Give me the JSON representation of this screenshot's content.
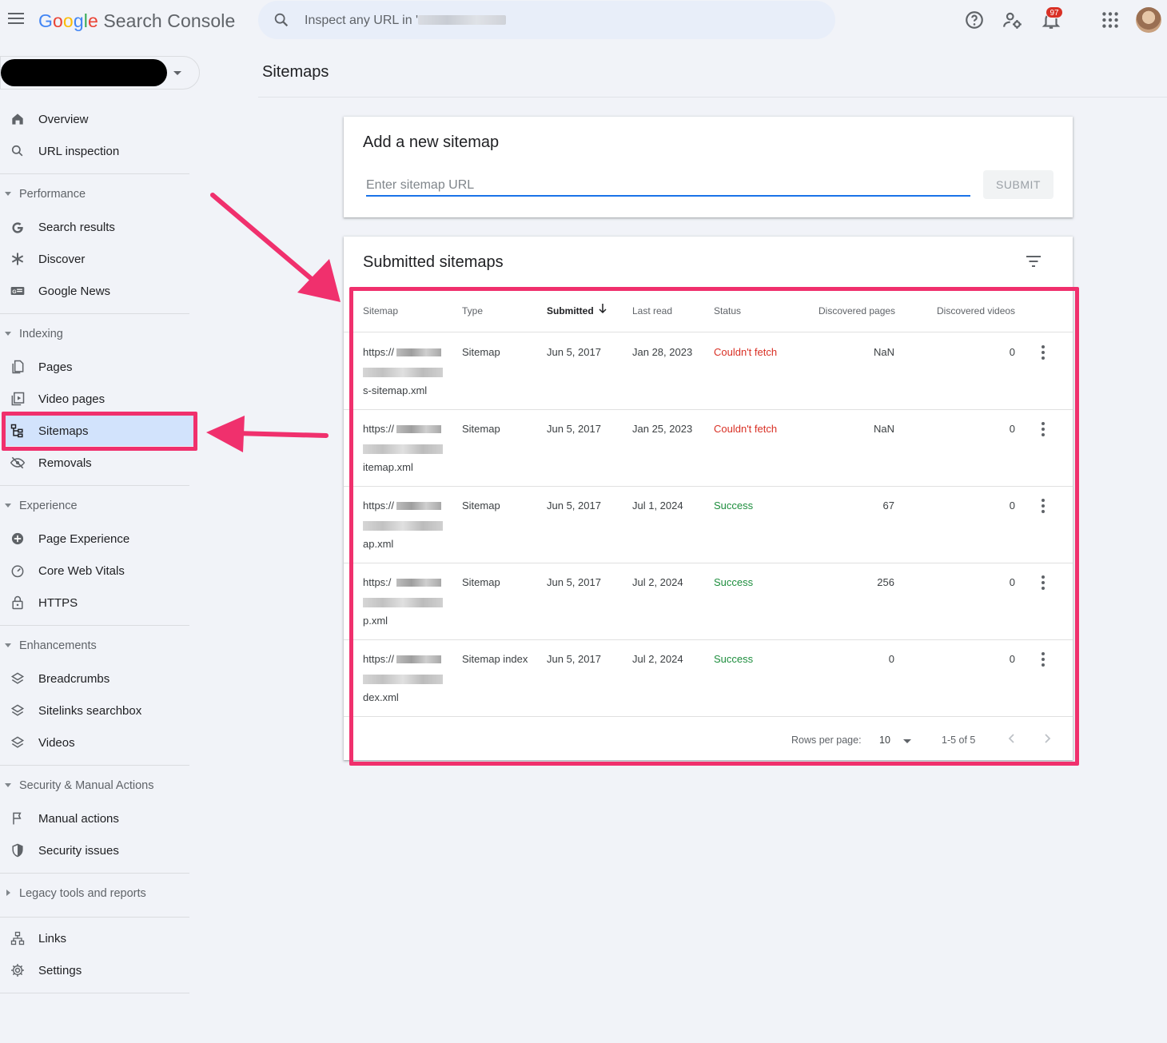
{
  "app": {
    "logo_letters": [
      "G",
      "o",
      "o",
      "g",
      "l",
      "e"
    ],
    "logo_rest": "Search Console",
    "search_placeholder": "Inspect any URL in '",
    "notification_count": "97"
  },
  "page": {
    "title": "Sitemaps"
  },
  "sidebar": {
    "top_items": [
      {
        "label": "Overview",
        "icon": "home-icon"
      },
      {
        "label": "URL inspection",
        "icon": "search-icon"
      }
    ],
    "sections": [
      {
        "title": "Performance",
        "items": [
          {
            "label": "Search results",
            "icon": "google-g-icon"
          },
          {
            "label": "Discover",
            "icon": "asterisk-icon"
          },
          {
            "label": "Google News",
            "icon": "news-icon"
          }
        ]
      },
      {
        "title": "Indexing",
        "items": [
          {
            "label": "Pages",
            "icon": "pages-icon"
          },
          {
            "label": "Video pages",
            "icon": "video-page-icon"
          },
          {
            "label": "Sitemaps",
            "icon": "sitemap-icon",
            "active": true
          },
          {
            "label": "Removals",
            "icon": "eye-off-icon"
          }
        ]
      },
      {
        "title": "Experience",
        "items": [
          {
            "label": "Page Experience",
            "icon": "plus-circle-icon"
          },
          {
            "label": "Core Web Vitals",
            "icon": "speed-gauge-icon"
          },
          {
            "label": "HTTPS",
            "icon": "lock-icon"
          }
        ]
      },
      {
        "title": "Enhancements",
        "items": [
          {
            "label": "Breadcrumbs",
            "icon": "layers-icon"
          },
          {
            "label": "Sitelinks searchbox",
            "icon": "layers-icon"
          },
          {
            "label": "Videos",
            "icon": "layers-icon"
          }
        ]
      },
      {
        "title": "Security & Manual Actions",
        "items": [
          {
            "label": "Manual actions",
            "icon": "flag-icon"
          },
          {
            "label": "Security issues",
            "icon": "shield-icon"
          }
        ]
      },
      {
        "title": "Legacy tools and reports",
        "collapsed": true
      }
    ],
    "bottom_items": [
      {
        "label": "Links",
        "icon": "network-icon"
      },
      {
        "label": "Settings",
        "icon": "gear-icon"
      }
    ]
  },
  "add_sitemap": {
    "title": "Add a new sitemap",
    "input_placeholder": "Enter sitemap URL",
    "submit_label": "SUBMIT"
  },
  "submitted": {
    "title": "Submitted sitemaps",
    "columns": [
      "Sitemap",
      "Type",
      "Submitted",
      "Last read",
      "Status",
      "Discovered pages",
      "Discovered videos"
    ],
    "rows": [
      {
        "url_start": "https://",
        "url_end": "s-sitemap.xml",
        "type": "Sitemap",
        "submitted": "Jun 5, 2017",
        "last_read": "Jan 28, 2023",
        "status": "Couldn't fetch",
        "status_kind": "error",
        "pages": "NaN",
        "videos": "0"
      },
      {
        "url_start": "https://",
        "url_end": "itemap.xml",
        "type": "Sitemap",
        "submitted": "Jun 5, 2017",
        "last_read": "Jan 25, 2023",
        "status": "Couldn't fetch",
        "status_kind": "error",
        "pages": "NaN",
        "videos": "0"
      },
      {
        "url_start": "https://",
        "url_end": "ap.xml",
        "type": "Sitemap",
        "submitted": "Jun 5, 2017",
        "last_read": "Jul 1, 2024",
        "status": "Success",
        "status_kind": "ok",
        "pages": "67",
        "videos": "0"
      },
      {
        "url_start": "https:/",
        "url_end": "p.xml",
        "type": "Sitemap",
        "submitted": "Jun 5, 2017",
        "last_read": "Jul 2, 2024",
        "status": "Success",
        "status_kind": "ok",
        "pages": "256",
        "videos": "0"
      },
      {
        "url_start": "https://",
        "url_end": "dex.xml",
        "type": "Sitemap index",
        "submitted": "Jun 5, 2017",
        "last_read": "Jul 2, 2024",
        "status": "Success",
        "status_kind": "ok",
        "pages": "0",
        "videos": "0"
      }
    ],
    "footer": {
      "rows_per_page_label": "Rows per page:",
      "rows_per_page": "10",
      "range": "1-5 of 5"
    }
  },
  "colors": {
    "highlight": "#f0306d",
    "accent": "#1a73e8",
    "error": "#d93025",
    "success": "#1e8e3e",
    "active_bg": "#d2e3fc"
  }
}
